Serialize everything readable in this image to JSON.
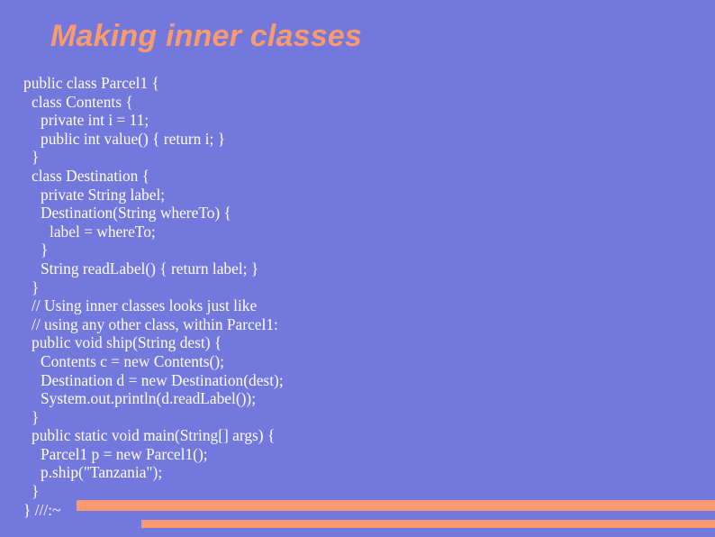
{
  "slide": {
    "title": "Making inner classes",
    "background_color": "#7378DC",
    "title_color": "#FA9A6E",
    "code_color": "#FFFFFF",
    "accent_color": "#FA9A6E"
  },
  "code": {
    "language": "java",
    "lines": [
      {
        "indent": 0,
        "text": "public class Parcel1 {"
      },
      {
        "indent": 1,
        "text": "class Contents {"
      },
      {
        "indent": 2,
        "text": "private int i = 11;"
      },
      {
        "indent": 2,
        "text": "public int value() { return i; }"
      },
      {
        "indent": 1,
        "text": "}"
      },
      {
        "indent": 1,
        "text": "class Destination {"
      },
      {
        "indent": 2,
        "text": "private String label;"
      },
      {
        "indent": 2,
        "text": "Destination(String whereTo) {"
      },
      {
        "indent": 3,
        "text": "label = whereTo;"
      },
      {
        "indent": 2,
        "text": "}"
      },
      {
        "indent": 2,
        "text": "String readLabel() { return label; }"
      },
      {
        "indent": 1,
        "text": "}"
      },
      {
        "indent": 1,
        "text": "// Using inner classes looks just like"
      },
      {
        "indent": 1,
        "text": "// using any other class, within Parcel1:"
      },
      {
        "indent": 1,
        "text": "public void ship(String dest) {"
      },
      {
        "indent": 2,
        "text": "Contents c = new Contents();"
      },
      {
        "indent": 2,
        "text": "Destination d = new Destination(dest);"
      },
      {
        "indent": 2,
        "text": "System.out.println(d.readLabel());"
      },
      {
        "indent": 1,
        "text": "}"
      },
      {
        "indent": 1,
        "text": "public static void main(String[] args) {"
      },
      {
        "indent": 2,
        "text": "Parcel1 p = new Parcel1();"
      },
      {
        "indent": 2,
        "text": "p.ship(\"Tanzania\");"
      },
      {
        "indent": 1,
        "text": "}"
      },
      {
        "indent": 0,
        "text": "} ///:~"
      }
    ]
  }
}
